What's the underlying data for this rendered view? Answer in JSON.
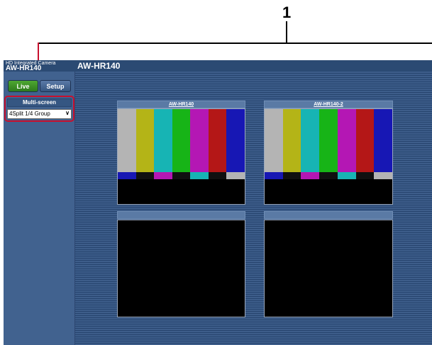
{
  "callout": {
    "number": "1"
  },
  "header": {
    "product_line": "HD Integrated Camera",
    "product_model": "AW-HR140",
    "page_model": "AW-HR140"
  },
  "nav": {
    "live_label": "Live",
    "setup_label": "Setup"
  },
  "multi_screen": {
    "label": "Multi-screen",
    "selected": "4Split 1/4 Group"
  },
  "tiles": [
    {
      "title": "AW-HR140",
      "content": "color-bars"
    },
    {
      "title": "AW-HR140-2",
      "content": "color-bars"
    },
    {
      "title": "",
      "content": "black"
    },
    {
      "title": "",
      "content": "black"
    }
  ],
  "colors": {
    "header_bg": "#2b4a73",
    "sidebar_bg": "#41628f",
    "live_btn": "#3b8f26",
    "callout_highlight": "#c8102e",
    "bars_top": [
      "#b4b4b4",
      "#b4b417",
      "#17b4b4",
      "#17b417",
      "#b417b4",
      "#b41717",
      "#1717b4"
    ],
    "bars_mid": [
      "#1717b4",
      "#101010",
      "#b417b4",
      "#101010",
      "#17b4b4",
      "#101010",
      "#b4b4b4"
    ],
    "bars_bot": [
      "#061c3a",
      "#ebebeb",
      "#2b0a5a",
      "#101010",
      "#080808",
      "#1a1a1a",
      "#101010"
    ]
  }
}
